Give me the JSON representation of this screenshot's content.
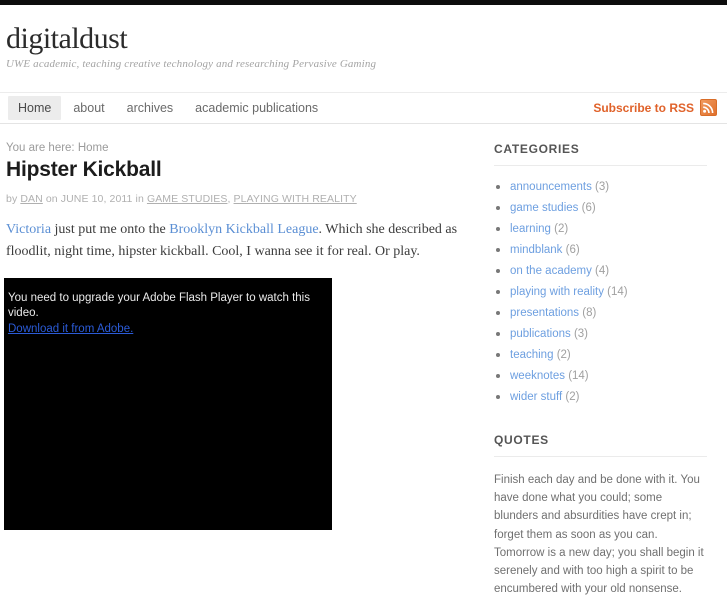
{
  "site": {
    "title": "digitaldust",
    "tagline": "UWE academic, teaching creative technology and researching Pervasive Gaming"
  },
  "nav": {
    "items": [
      {
        "label": "Home",
        "active": true
      },
      {
        "label": "about",
        "active": false
      },
      {
        "label": "archives",
        "active": false
      },
      {
        "label": "academic publications",
        "active": false
      }
    ],
    "rss_label": "Subscribe to RSS",
    "rss_icon": "rss-icon"
  },
  "post": {
    "breadcrumb": "You are here: Home",
    "title": "Hipster Kickball",
    "byline": {
      "by_prefix": "by",
      "author": "DAN",
      "on_text": "on",
      "date": "JUNE 10, 2011",
      "in_text": "in",
      "category_1": "GAME STUDIES",
      "separator": ",",
      "category_2": "PLAYING WITH REALITY"
    },
    "body": {
      "link_1": "Victoria",
      "text_1": " just put me onto the ",
      "link_2": "Brooklyn Kickball League",
      "text_2": ". Which she described as floodlit, night time, hipster kickball. Cool, I wanna see it for real. Or play."
    },
    "video": {
      "flash_message": "You need to upgrade your Adobe Flash Player to watch this video.",
      "download_link": "Download it from Adobe."
    }
  },
  "sidebar": {
    "categories": {
      "title": "CATEGORIES",
      "items": [
        {
          "label": "announcements",
          "count": "(3)"
        },
        {
          "label": "game studies",
          "count": "(6)"
        },
        {
          "label": "learning",
          "count": "(2)"
        },
        {
          "label": "mindblank",
          "count": "(6)"
        },
        {
          "label": "on the academy",
          "count": "(4)"
        },
        {
          "label": "playing with reality",
          "count": "(14)"
        },
        {
          "label": "presentations",
          "count": "(8)"
        },
        {
          "label": "publications",
          "count": "(3)"
        },
        {
          "label": "teaching",
          "count": "(2)"
        },
        {
          "label": "weeknotes",
          "count": "(14)"
        },
        {
          "label": "wider stuff",
          "count": "(2)"
        }
      ]
    },
    "quotes": {
      "title": "QUOTES",
      "text": "Finish each day and be done with it. You have done what you could; some blunders and absurdities have crept in; forget them as soon as you can. Tomorrow is a new day; you shall begin it serenely and with too high a spirit to be encumbered with your old nonsense."
    }
  },
  "colors": {
    "accent_orange": "#e0622a",
    "link_blue": "#5b8fd4",
    "sidebar_link_blue": "#6d9fe0",
    "flash_link_blue": "#2b5bd7"
  }
}
